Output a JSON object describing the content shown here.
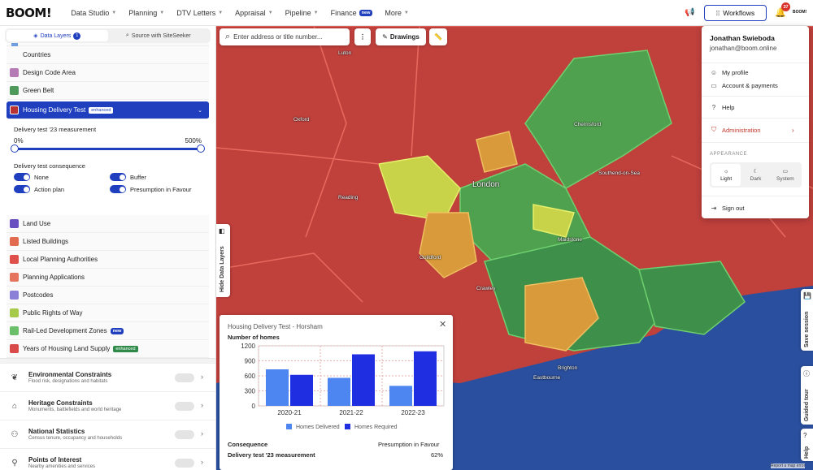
{
  "app": {
    "logo": "BOOM!",
    "logo_small": "BOOM!"
  },
  "nav": [
    {
      "label": "Data Studio",
      "chevron": true
    },
    {
      "label": "Planning",
      "chevron": true
    },
    {
      "label": "DTV Letters",
      "chevron": true
    },
    {
      "label": "Appraisal",
      "chevron": true
    },
    {
      "label": "Pipeline",
      "chevron": true
    },
    {
      "label": "Finance",
      "badge": "new"
    },
    {
      "label": "More",
      "chevron": true
    }
  ],
  "header": {
    "workflows_label": "Workflows",
    "notification_count": "37"
  },
  "sidebar": {
    "tabs": [
      {
        "label": "Data Layers",
        "count": "1"
      },
      {
        "label": "Source with SiteSeeker"
      }
    ],
    "layers_top": [
      {
        "label": "Countries",
        "color": ""
      },
      {
        "label": "Design Code Area",
        "color": "#b57bb5"
      },
      {
        "label": "Green Belt",
        "color": "#4f9a5a"
      }
    ],
    "selected_layer": {
      "label": "Housing Delivery Test",
      "badge": "enhanced",
      "color": "#b83232"
    },
    "measurement_label": "Delivery test '23 measurement",
    "slider_min": "0%",
    "slider_max": "500%",
    "consequence_label": "Delivery test consequence",
    "toggles": [
      {
        "label": "None"
      },
      {
        "label": "Buffer"
      },
      {
        "label": "Action plan"
      },
      {
        "label": "Presumption in Favour"
      }
    ],
    "layers_bottom": [
      {
        "label": "Land Use",
        "color": "#6a4fc0"
      },
      {
        "label": "Listed Buildings",
        "color": "#e26b4f"
      },
      {
        "label": "Local Planning Authorities",
        "color": "#e0504a"
      },
      {
        "label": "Planning Applications",
        "color": "#e5755f"
      },
      {
        "label": "Postcodes",
        "color": "#8c7fd8"
      },
      {
        "label": "Public Rights of Way",
        "color": "#a7c94a"
      },
      {
        "label": "Rail-Led Development Zones",
        "color": "#6bbf6b",
        "badge": "new"
      },
      {
        "label": "Years of Housing Land Supply",
        "color": "#d94a4a",
        "badge": "enhanced"
      }
    ],
    "groups": [
      {
        "title": "Environmental Constraints",
        "sub": "Flood risk, designations and habitats",
        "icon": "leaf-icon"
      },
      {
        "title": "Heritage Constraints",
        "sub": "Monuments, battlefields and world heritage",
        "icon": "landmark-icon"
      },
      {
        "title": "National Statistics",
        "sub": "Census tenure, occupancy and households",
        "icon": "stats-icon"
      },
      {
        "title": "Points of Interest",
        "sub": "Nearby amenities and services",
        "icon": "pin-icon"
      }
    ]
  },
  "map": {
    "search_placeholder": "Enter address or title number...",
    "drawings_label": "Drawings",
    "hide_layers_label": "Hide Data Layers",
    "places": [
      "Luton",
      "Chelmsford",
      "Southend-on-Sea",
      "Oxford",
      "Reading",
      "London",
      "Guildford",
      "Crawley",
      "Brighton",
      "Eastbourne",
      "Maidstone"
    ],
    "attribution": "Report a map error"
  },
  "popup": {
    "title": "Housing Delivery Test - Horsham",
    "subtitle": "Number of homes",
    "consequence_label": "Consequence",
    "consequence_value": "Presumption in Favour",
    "measurement_label": "Delivery test '23 measurement",
    "measurement_value": "62%"
  },
  "chart_data": {
    "type": "bar",
    "title": "Number of homes",
    "categories": [
      "2020-21",
      "2021-22",
      "2022-23"
    ],
    "series": [
      {
        "name": "Homes Delivered",
        "values": [
          730,
          560,
          400
        ],
        "color": "#4d86f0"
      },
      {
        "name": "Homes Required",
        "values": [
          620,
          1030,
          1090
        ],
        "color": "#1f2ee0"
      }
    ],
    "ylim": [
      0,
      1200
    ],
    "yticks": [
      "0",
      "300",
      "600",
      "900",
      "1200"
    ],
    "legend": "bottom",
    "grid": true
  },
  "menu": {
    "name": "Jonathan Swieboda",
    "email": "jonathan@boom.online",
    "items": [
      {
        "label": "My profile",
        "icon": "user-icon"
      },
      {
        "label": "Account & payments",
        "icon": "card-icon"
      },
      {
        "label": "Help",
        "icon": "help-icon"
      },
      {
        "label": "Administration",
        "icon": "shield-icon"
      }
    ],
    "appearance_label": "APPEARANCE",
    "themes": [
      {
        "label": "Light"
      },
      {
        "label": "Dark"
      },
      {
        "label": "System"
      }
    ],
    "sign_out": "Sign out"
  },
  "right_tabs": {
    "save": "Save session",
    "tour": "Guided tour",
    "help": "Help"
  }
}
